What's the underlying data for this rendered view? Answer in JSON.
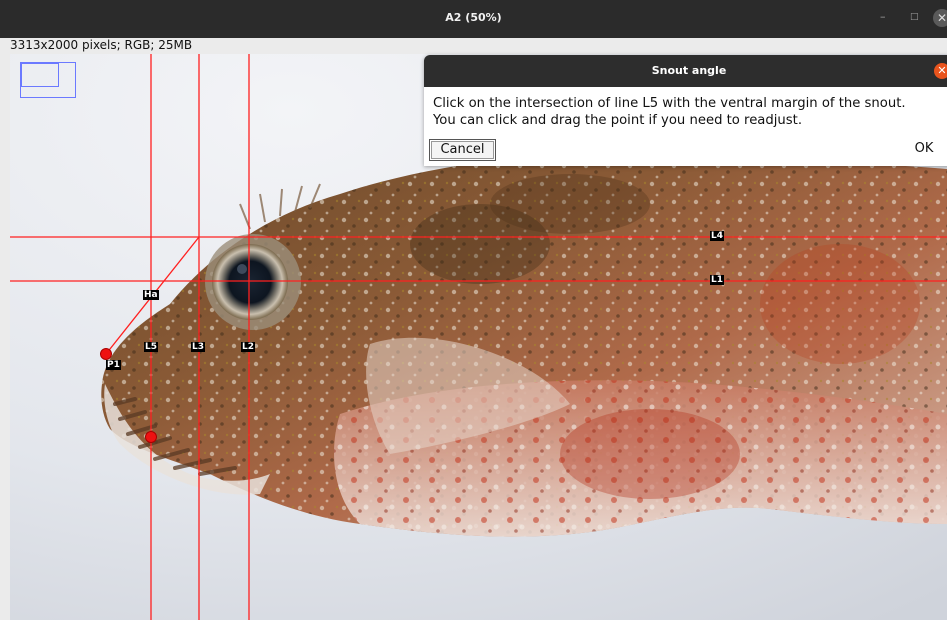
{
  "window": {
    "title": "A2 (50%)",
    "minimize_glyph": "–",
    "maximize_glyph": "□",
    "close_glyph": "✕"
  },
  "image_info": "3313x2000 pixels; RGB; 25MB",
  "dialog": {
    "title": "Snout angle",
    "close_glyph": "✕",
    "line1": "Click on the intersection of line L5 with the ventral margin of the snout.",
    "line2": "You can click and drag the point if you need to readjust.",
    "cancel_label": "Cancel",
    "ok_label": "OK"
  },
  "overlay": {
    "line_color": "#ff2020",
    "point_color": "#ee1111",
    "labels": {
      "l4": "L4",
      "l1": "L1",
      "ha": "Ha",
      "l5": "L5",
      "l3": "L3",
      "l2": "L2",
      "p1": "P1"
    }
  }
}
